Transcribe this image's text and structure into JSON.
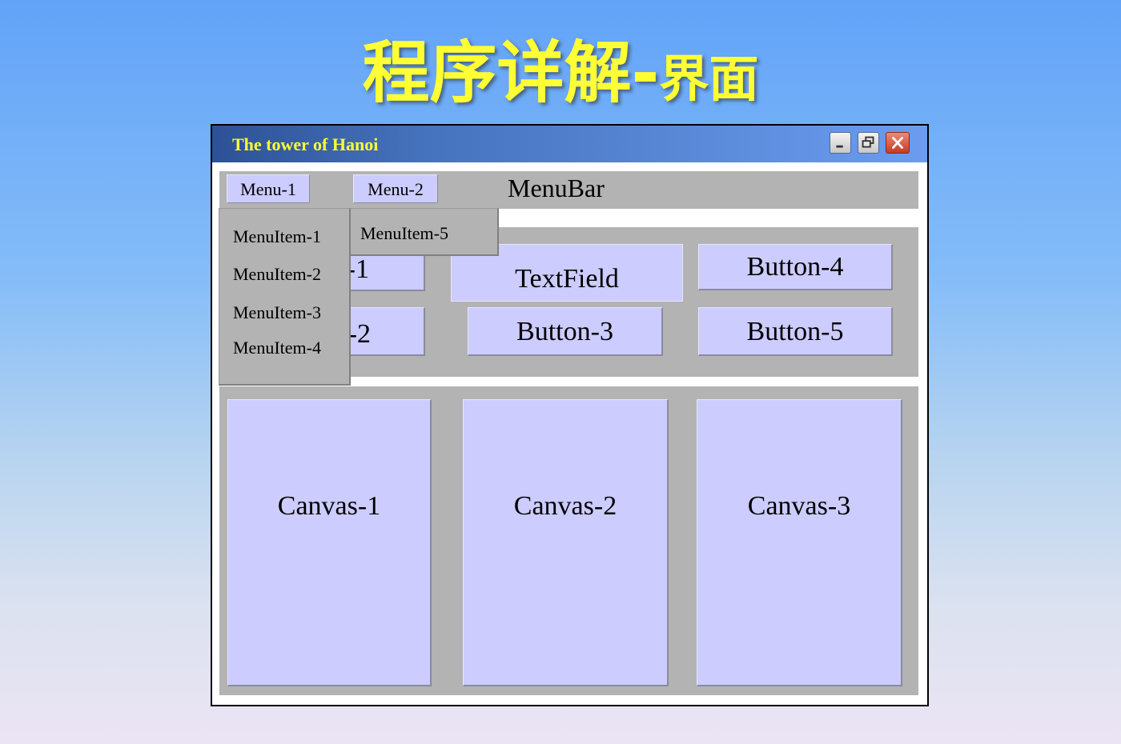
{
  "slide": {
    "title_main": "程序详解-",
    "title_sub": "界面"
  },
  "window": {
    "title": "The tower of Hanoi",
    "controls": [
      "minimize-icon",
      "restore-icon",
      "close-icon"
    ]
  },
  "menubar": {
    "label": "MenuBar",
    "menus": [
      "Menu-1",
      "Menu-2"
    ]
  },
  "dropdown_menu1": {
    "items": [
      "MenuItem-1",
      "MenuItem-2",
      "MenuItem-3",
      "MenuItem-4"
    ]
  },
  "dropdown_menu2": {
    "items": [
      "MenuItem-5"
    ]
  },
  "controls": {
    "button1_visible": "-1",
    "button2_visible": "-2",
    "textfield": "TextField",
    "button3": "Button-3",
    "button4": "Button-4",
    "button5": "Button-5"
  },
  "canvases": [
    "Canvas-1",
    "Canvas-2",
    "Canvas-3"
  ],
  "colors": {
    "component_fill": "#ccccff",
    "panel_gray": "#b3b3b3",
    "title_text": "#ffff33"
  }
}
